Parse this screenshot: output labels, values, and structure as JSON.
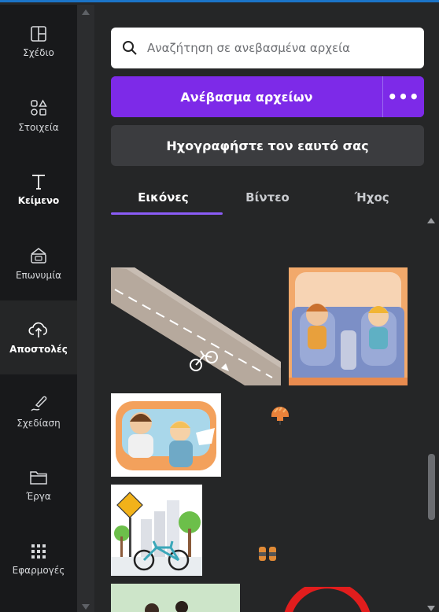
{
  "rail": {
    "items": [
      {
        "label": "Σχέδιο",
        "icon": "layout-icon"
      },
      {
        "label": "Στοιχεία",
        "icon": "elements-icon"
      },
      {
        "label": "Κείμενο",
        "icon": "text-icon"
      },
      {
        "label": "Επωνυμία",
        "icon": "brand-icon"
      },
      {
        "label": "Αποστολές",
        "icon": "upload-cloud-icon"
      },
      {
        "label": "Σχεδίαση",
        "icon": "draw-icon"
      },
      {
        "label": "Έργα",
        "icon": "folder-icon"
      },
      {
        "label": "Εφαρμογές",
        "icon": "apps-grid-icon"
      }
    ]
  },
  "search": {
    "placeholder": "Αναζήτηση σε ανεβασμένα αρχεία"
  },
  "upload": {
    "label": "Ανέβασμα αρχείων",
    "more": "•••"
  },
  "record": {
    "label": "Ηχογραφήστε τον εαυτό σας"
  },
  "tabs": [
    {
      "label": "Εικόνες"
    },
    {
      "label": "Βίντεο"
    },
    {
      "label": "Ήχος"
    }
  ],
  "colors": {
    "accent": "#7d2ae8",
    "panel": "#252627",
    "rail": "#18191b"
  }
}
